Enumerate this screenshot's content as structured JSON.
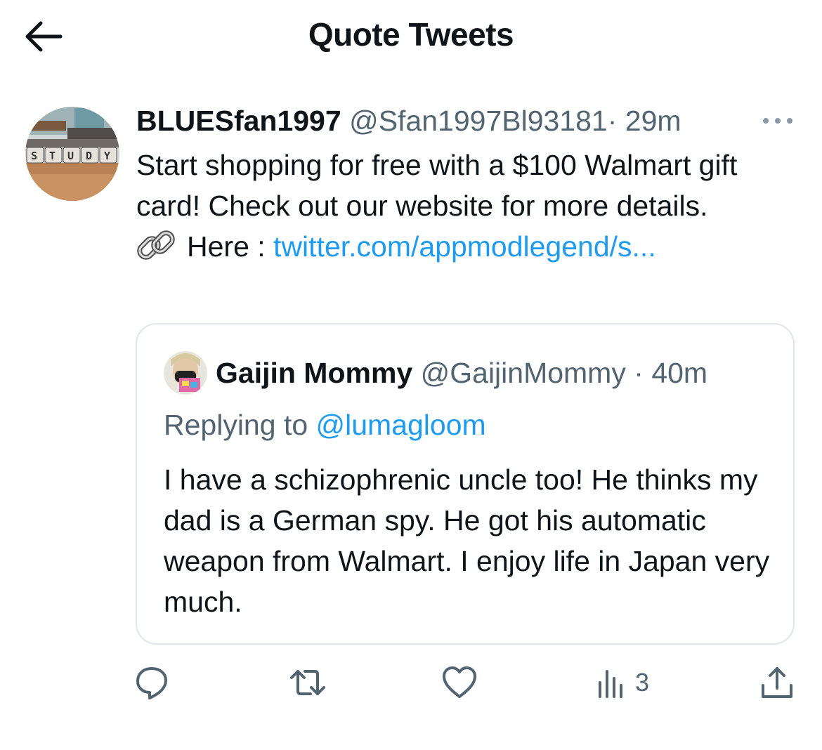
{
  "header": {
    "title": "Quote Tweets",
    "back_icon": "arrow-left-icon"
  },
  "tweet": {
    "display_name": "BLUESfan1997",
    "handle": "@Sfan1997Bl93181",
    "separator": "·",
    "time": "29m",
    "avatar_text": "STUDY",
    "text": "Start shopping for free with a $100 Walmart gift card! Check out our website for more details.",
    "link_prefix": "Here : ",
    "link_text": "twitter.com/appmodlegend/s...",
    "link_emoji": "link-icon"
  },
  "quoted": {
    "display_name": "Gaijin Mommy",
    "handle": "@GaijinMommy",
    "separator": "·",
    "time": "40m",
    "reply_prefix": "Replying to ",
    "reply_mention": "@lumagloom",
    "text": "I have a schizophrenic uncle too! He thinks my dad is a German spy. He got his automatic weapon from Walmart. I enjoy life in Japan very much."
  },
  "actions": {
    "views_count": "3",
    "icons": [
      "reply-icon",
      "retweet-icon",
      "like-icon",
      "views-icon",
      "share-icon"
    ]
  },
  "colors": {
    "accent": "#1d9bf0",
    "text": "#0f1419",
    "muted": "#536471",
    "border": "#e1e6ea"
  }
}
